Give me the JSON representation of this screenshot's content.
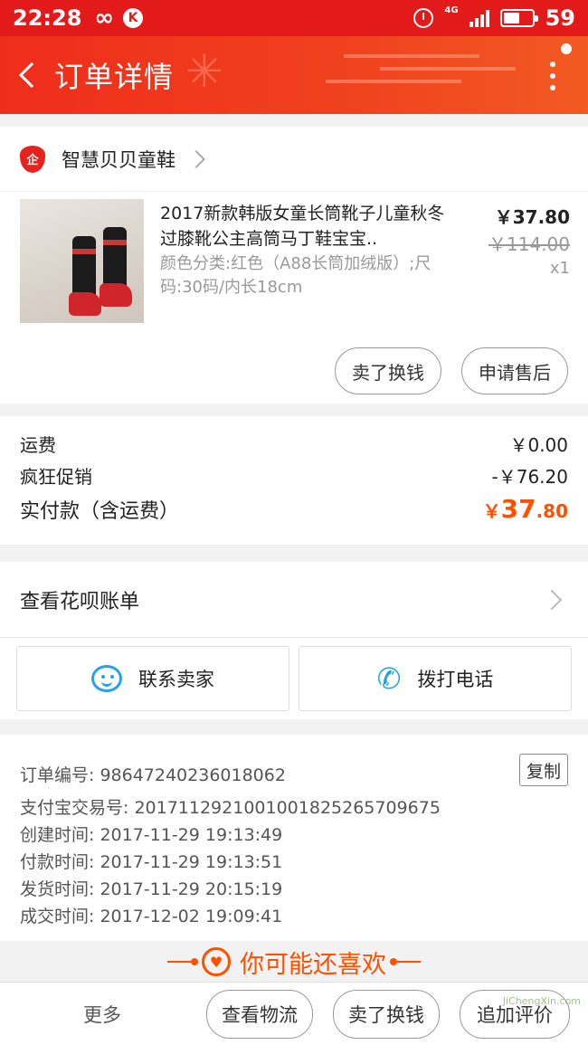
{
  "status_bar": {
    "time": "22:28",
    "infinity": "∞",
    "k_badge": "K",
    "network": "4G",
    "battery": "59"
  },
  "nav": {
    "title": "订单详情"
  },
  "shop": {
    "name": "智慧贝贝童鞋",
    "logo_text": "企"
  },
  "product": {
    "title": "2017新款韩版女童长筒靴子儿童秋冬过膝靴公主高筒马丁鞋宝宝..",
    "spec": "颜色分类:红色（A88长筒加绒版）;尺码:30码/内长18cm",
    "price_now": "￥37.80",
    "price_original": "￥114.00",
    "quantity": "x1",
    "actions": [
      "卖了换钱",
      "申请售后"
    ]
  },
  "fees": {
    "shipping_label": "运费",
    "shipping_value": "￥0.00",
    "promo_label": "疯狂促销",
    "promo_value": "-￥76.20",
    "paid_label": "实付款（含运费）",
    "paid_currency": "￥",
    "paid_int": "37",
    "paid_dec": ".80"
  },
  "huabei": {
    "label": "查看花呗账单"
  },
  "contact": {
    "seller": "联系卖家",
    "phone": "拨打电话"
  },
  "order_info": {
    "order_no": "订单编号: 98647240236018062",
    "copy_label": "复制",
    "alipay_no": "支付宝交易号: 2017112921001001825265709675",
    "created": "创建时间: 2017-11-29 19:13:49",
    "paid": "付款时间: 2017-11-29 19:13:51",
    "shipped": "发货时间: 2017-11-29 20:15:19",
    "completed": "成交时间: 2017-12-02 19:09:41"
  },
  "recommend": {
    "title": "你可能还喜欢"
  },
  "bottom": {
    "more": "更多",
    "logistics": "查看物流",
    "resell": "卖了换钱",
    "review": "追加评价"
  },
  "watermark": "JiChengXin.com",
  "colors": {
    "brand_red": "#e21a1a",
    "accent_orange": "#ff5000",
    "icon_blue": "#29a1e6"
  }
}
